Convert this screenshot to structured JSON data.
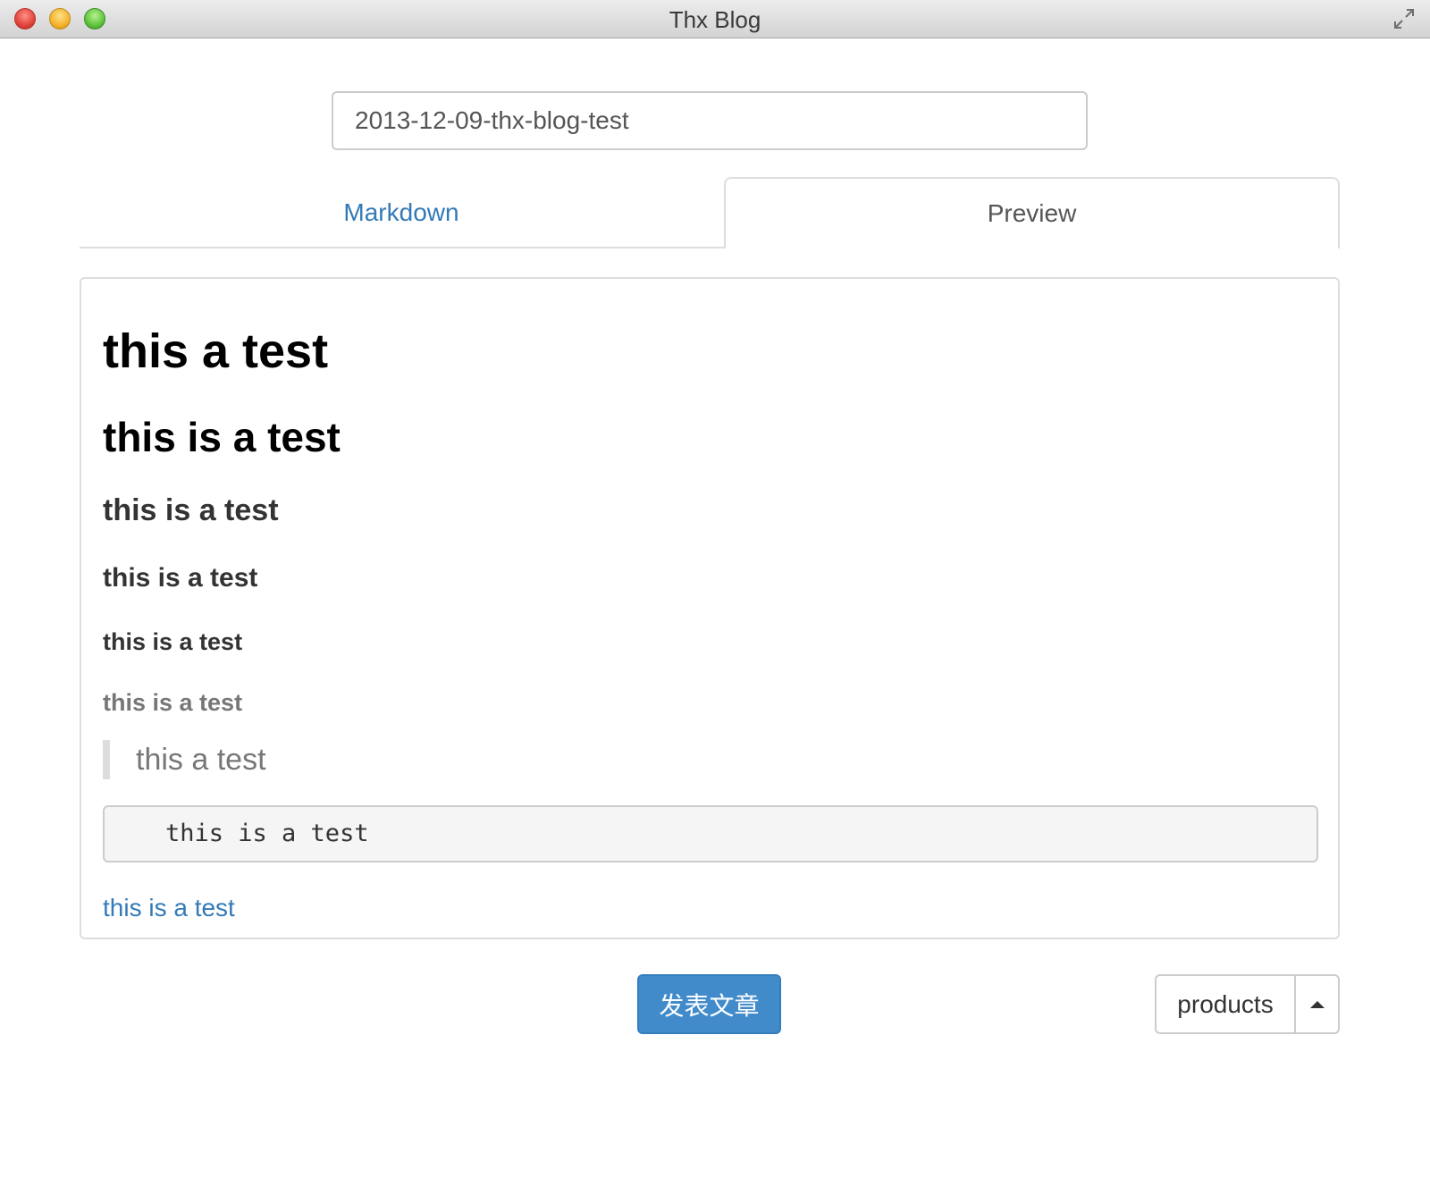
{
  "window": {
    "title": "Thx Blog"
  },
  "editor": {
    "filename": "2013-12-09-thx-blog-test"
  },
  "tabs": [
    {
      "label": "Markdown",
      "active": false
    },
    {
      "label": "Preview",
      "active": true
    }
  ],
  "preview": {
    "h1": "this a test",
    "h2": "this is a test",
    "h3": "this is a test",
    "h4": "this is a test",
    "h5": "this is a test",
    "h6": "this is a test",
    "blockquote": "this a test",
    "code": "this is a test",
    "link": "this is a test"
  },
  "actions": {
    "publish_label": "发表文章",
    "category_label": "products"
  },
  "colors": {
    "accent": "#337ab7",
    "primary_button": "#428bca",
    "border": "#dddddd",
    "muted_text": "#777777"
  },
  "icons": {
    "fullscreen": "fullscreen-icon",
    "dropdown": "caret-up-icon"
  }
}
